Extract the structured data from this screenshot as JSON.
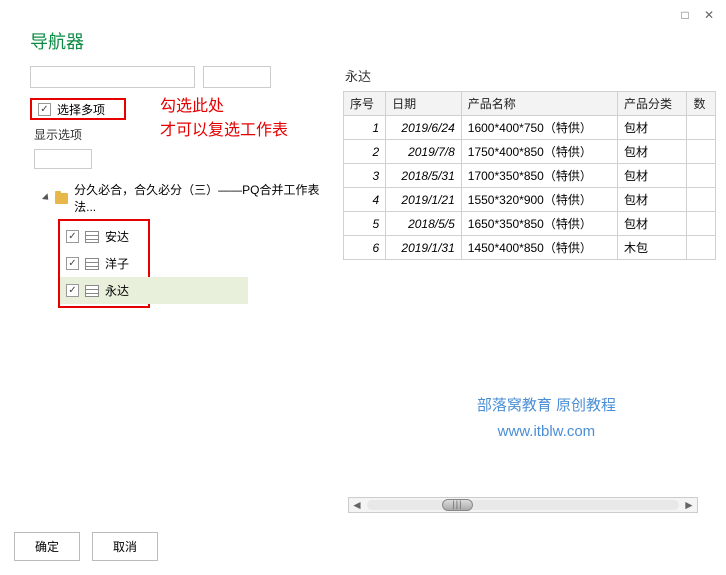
{
  "window": {
    "title": "导航器",
    "maximize_icon": "□",
    "close_icon": "✕"
  },
  "left": {
    "multi_select_label": "选择多项",
    "display_options_label": "显示选项",
    "annotation_line1": "勾选此处",
    "annotation_line2": "才可以复选工作表",
    "root_label": "分久必合，合久必分（三）——PQ合并工作表法...",
    "sheets": [
      {
        "label": "安达"
      },
      {
        "label": "洋子"
      },
      {
        "label": "永达"
      }
    ]
  },
  "preview": {
    "title": "永达",
    "columns": {
      "c1": "序号",
      "c2": "日期",
      "c3": "产品名称",
      "c4": "产品分类",
      "c5": "数"
    },
    "rows": [
      {
        "n": "1",
        "date": "2019/6/24",
        "name": "1600*400*750（特供）",
        "cat": "包材"
      },
      {
        "n": "2",
        "date": "2019/7/8",
        "name": "1750*400*850（特供）",
        "cat": "包材"
      },
      {
        "n": "3",
        "date": "2018/5/31",
        "name": "1700*350*850（特供）",
        "cat": "包材"
      },
      {
        "n": "4",
        "date": "2019/1/21",
        "name": "1550*320*900（特供）",
        "cat": "包材"
      },
      {
        "n": "5",
        "date": "2018/5/5",
        "name": "1650*350*850（特供）",
        "cat": "包材"
      },
      {
        "n": "6",
        "date": "2019/1/31",
        "name": "1450*400*850（特供）",
        "cat": "木包"
      }
    ]
  },
  "watermark": {
    "line1": "部落窝教育  原创教程",
    "line2": "www.itblw.com"
  },
  "buttons": {
    "ok": "确定",
    "cancel": "取消"
  },
  "scroll": {
    "left_arrow": "◄",
    "right_arrow": "►"
  }
}
